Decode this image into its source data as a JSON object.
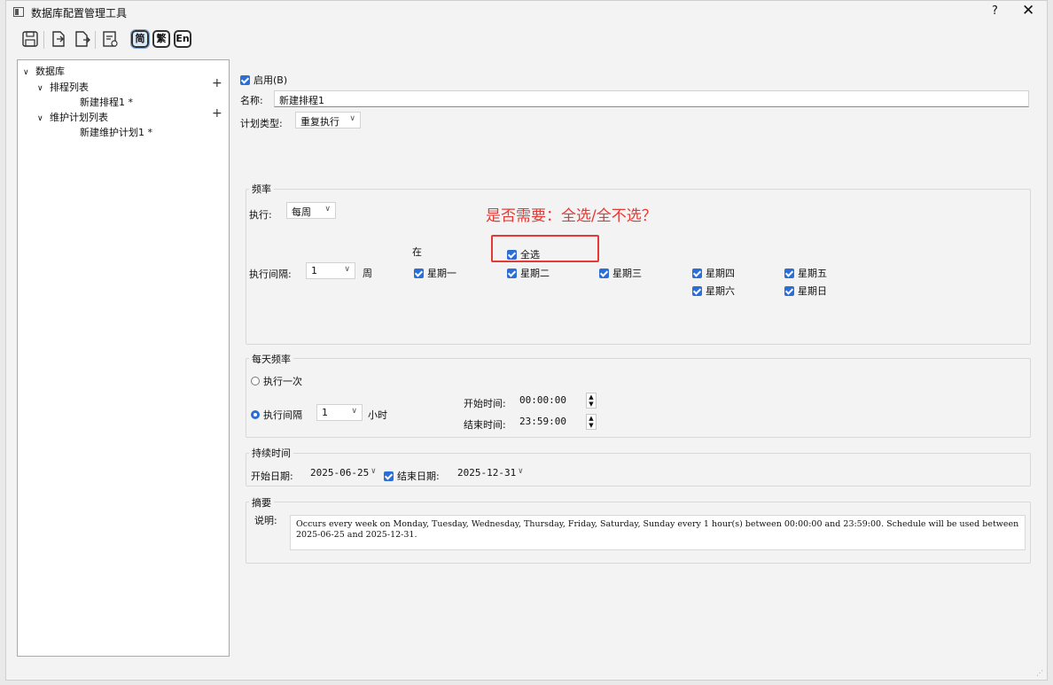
{
  "window": {
    "title": "数据库配置管理工具",
    "help": "?",
    "close": "✕"
  },
  "toolbar": {
    "lang_simplified": "简",
    "lang_traditional": "繁",
    "lang_english": "En"
  },
  "tree": {
    "root": "数据库",
    "schedule_list": "排程列表",
    "schedule_item": "新建排程1 *",
    "maintenance_list": "维护计划列表",
    "maintenance_item": "新建维护计划1 *",
    "add": "+"
  },
  "form": {
    "enable_label": "启用(B)",
    "name_label": "名称:",
    "name_value": "新建排程1",
    "plan_type_label": "计划类型:",
    "plan_type_value": "重复执行"
  },
  "frequency": {
    "group_title": "频率",
    "exec_label": "执行:",
    "exec_value": "每周",
    "interval_label": "执行间隔:",
    "interval_value": "1",
    "interval_unit": "周",
    "on_label": "在",
    "select_all": "全选",
    "days": {
      "mon": "星期一",
      "tue": "星期二",
      "wed": "星期三",
      "thu": "星期四",
      "fri": "星期五",
      "sat": "星期六",
      "sun": "星期日"
    }
  },
  "daily": {
    "group_title": "每天频率",
    "once_label": "执行一次",
    "interval_label": "执行间隔",
    "interval_value": "1",
    "interval_unit": "小时",
    "start_label": "开始时间:",
    "start_value": "00:00:00",
    "end_label": "结束时间:",
    "end_value": "23:59:00"
  },
  "duration": {
    "group_title": "持续时间",
    "start_date_label": "开始日期:",
    "start_date_value": "2025-06-25",
    "end_date_label": "结束日期:",
    "end_date_value": "2025-12-31"
  },
  "summary": {
    "group_title": "摘要",
    "desc_label": "说明:",
    "desc_text": "Occurs every week on Monday, Tuesday, Wednesday, Thursday, Friday, Saturday, Sunday every 1 hour(s) between 00:00:00 and 23:59:00. Schedule will be used between 2025-06-25 and 2025-12-31."
  },
  "annotation": {
    "text": "是否需要：全选/全不选？",
    "color": "#e53935"
  },
  "colors": {
    "accent": "#2b6fd6"
  }
}
